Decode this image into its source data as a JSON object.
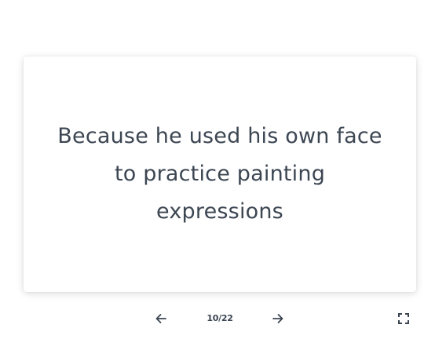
{
  "card": {
    "text": "Because he used his own face to practice painting expressions"
  },
  "controls": {
    "counter": "10/22",
    "prev_icon": "arrow-left-icon",
    "next_icon": "arrow-right-icon",
    "fullscreen_icon": "fullscreen-icon"
  },
  "colors": {
    "text": "#3c4652",
    "background": "#ffffff"
  }
}
